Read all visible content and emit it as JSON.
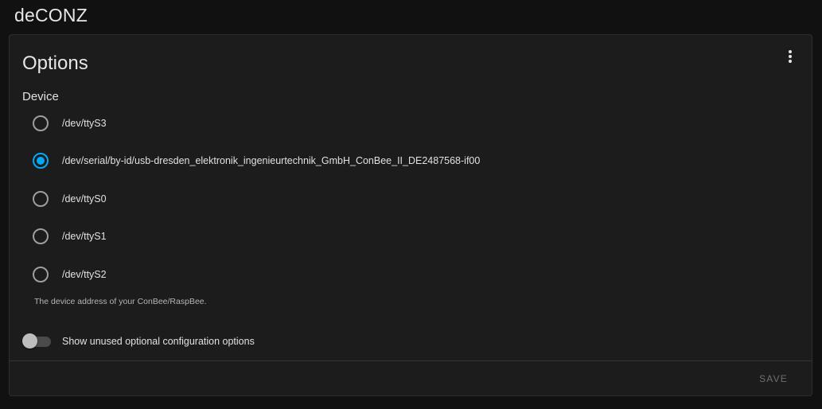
{
  "header": {
    "title": "deCONZ"
  },
  "card": {
    "title": "Options",
    "menu_icon": "dots-vertical-icon",
    "device_field": {
      "label": "Device",
      "options": [
        {
          "label": "/dev/ttyS3",
          "checked": false
        },
        {
          "label": "/dev/serial/by-id/usb-dresden_elektronik_ingenieurtechnik_GmbH_ConBee_II_DE2487568-if00",
          "checked": true
        },
        {
          "label": "/dev/ttyS0",
          "checked": false
        },
        {
          "label": "/dev/ttyS1",
          "checked": false
        },
        {
          "label": "/dev/ttyS2",
          "checked": false
        }
      ],
      "helper": "The device address of your ConBee/RaspBee."
    },
    "toggle": {
      "label": "Show unused optional configuration options",
      "on": false
    },
    "actions": {
      "save_label": "SAVE",
      "save_enabled": false
    }
  },
  "colors": {
    "background": "#111111",
    "card": "#1c1c1c",
    "accent": "#03a9f4"
  }
}
